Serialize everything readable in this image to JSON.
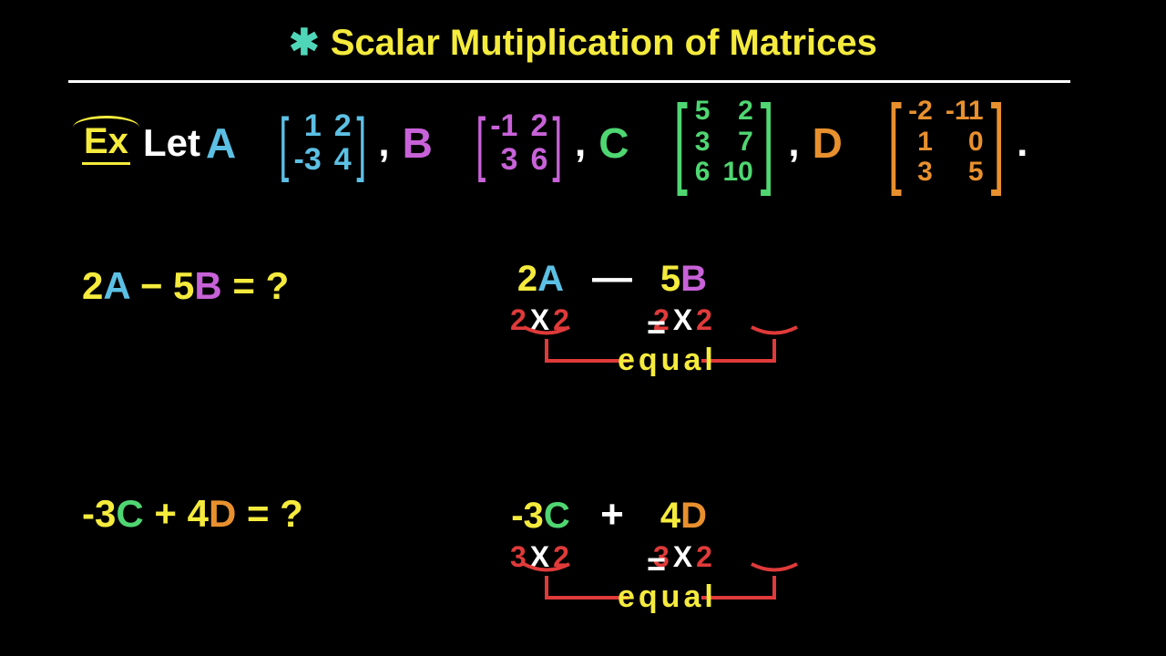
{
  "title": {
    "asterisk": "✱",
    "text": "Scalar Mutiplication of Matrices"
  },
  "ex": "Ex",
  "let": "Let",
  "defs": {
    "A": {
      "label": "A",
      "eq": "=",
      "cells": [
        "1",
        "2",
        "-3",
        "4"
      ]
    },
    "B": {
      "label": "B",
      "eq": "=",
      "cells": [
        "-1",
        "2",
        "3",
        "6"
      ]
    },
    "C": {
      "label": "C",
      "eq": "=",
      "cells": [
        "5",
        "2",
        "3",
        "7",
        "6",
        "10"
      ]
    },
    "D": {
      "label": "D",
      "eq": "=",
      "cells": [
        "-2",
        "-11",
        "1",
        "0",
        "3",
        "5"
      ]
    },
    "comma": ",",
    "period": "."
  },
  "problems": {
    "p1": {
      "coef1": "2",
      "m1": "A",
      "op": "−",
      "coef2": "5",
      "m2": "B",
      "eqq": "= ?"
    },
    "p2": {
      "coef1": "-3",
      "m1": "C",
      "op": "+",
      "coef2": "4",
      "m2": "D",
      "eqq": "= ?"
    }
  },
  "work": {
    "w1": {
      "t1coef": "2",
      "t1m": "A",
      "op": "—",
      "t2coef": "5",
      "t2m": "B",
      "dim1": {
        "r": "2",
        "x": "X",
        "c": "2"
      },
      "dim2": {
        "r": "2",
        "x": "X",
        "c": "2"
      },
      "eqsign": "=",
      "equal": "equal"
    },
    "w2": {
      "t1coef": "-3",
      "t1m": "C",
      "op": "+",
      "t2coef": "4",
      "t2m": "D",
      "dim1": {
        "r": "3",
        "x": "X",
        "c": "2"
      },
      "dim2": {
        "r": "3",
        "x": "X",
        "c": "2"
      },
      "eqsign": "=",
      "equal": "equal"
    }
  }
}
